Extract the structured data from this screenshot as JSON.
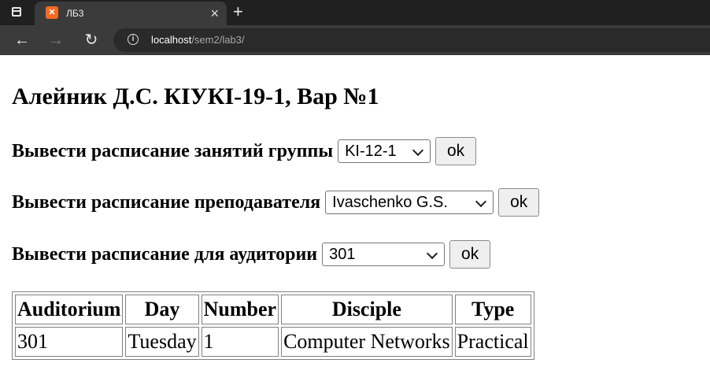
{
  "browser": {
    "tab": {
      "favicon": "xampp-icon",
      "title": "ЛБ3",
      "close": "×"
    },
    "new_tab": "+",
    "nav": {
      "back": "←",
      "forward": "→",
      "reload": "↻"
    },
    "address": {
      "host": "localhost",
      "path": "/sem2/lab3/"
    }
  },
  "page": {
    "title": "Алейник Д.С. КІУКІ-19-1, Вар №1",
    "group_row": {
      "label": "Вывести расписание занятий группы",
      "selected": "KI-12-1",
      "button": "ok"
    },
    "teacher_row": {
      "label": "Вывести расписание преподавателя",
      "selected": "Ivaschenko G.S.",
      "button": "ok"
    },
    "room_row": {
      "label": "Вывести расписание для аудитории",
      "selected": "301",
      "button": "ok"
    },
    "table": {
      "headers": [
        "Auditorium",
        "Day",
        "Number",
        "Disciple",
        "Type"
      ],
      "rows": [
        [
          "301",
          "Tuesday",
          "1",
          "Computer Networks",
          "Practical"
        ]
      ]
    }
  }
}
